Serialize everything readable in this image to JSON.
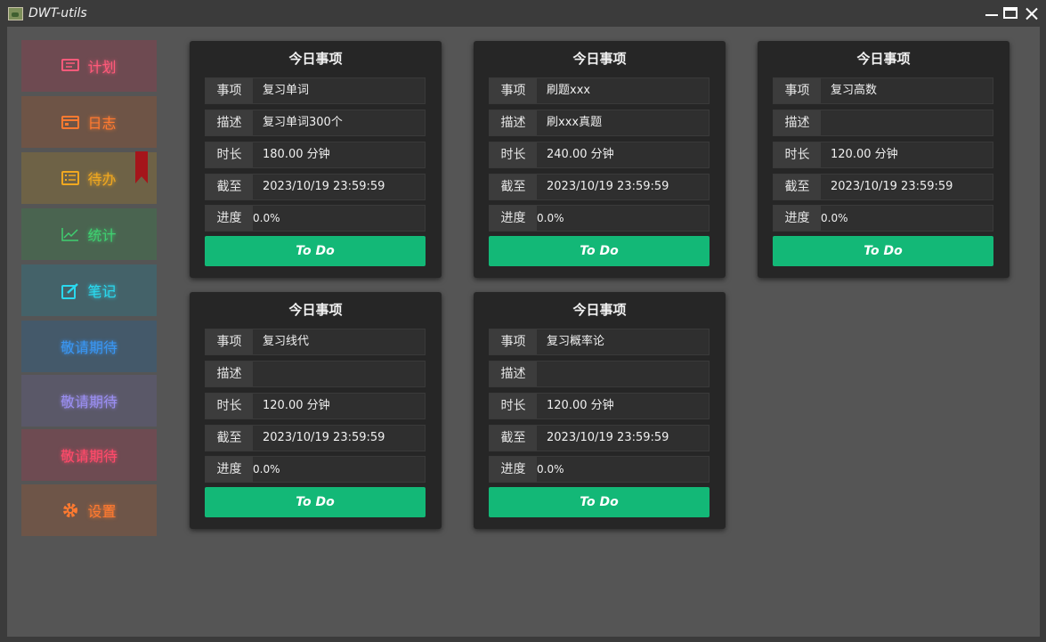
{
  "window": {
    "title": "DWT-utils"
  },
  "sidebar": {
    "items": [
      {
        "label": "计划",
        "icon": "monitor-icon",
        "bg": "#6e4a51",
        "fg": "#ff5a7a"
      },
      {
        "label": "日志",
        "icon": "calendar-icon",
        "bg": "#6e5446",
        "fg": "#ff7a30"
      },
      {
        "label": "待办",
        "icon": "checklist-icon",
        "bg": "#6e6246",
        "fg": "#f0a820"
      },
      {
        "label": "统计",
        "icon": "line-chart-icon",
        "bg": "#4a6450",
        "fg": "#3fcf70"
      },
      {
        "label": "笔记",
        "icon": "edit-icon",
        "bg": "#446269",
        "fg": "#2ad8ee"
      },
      {
        "label": "敬请期待",
        "icon": "",
        "bg": "#44596a",
        "fg": "#3a95f0"
      },
      {
        "label": "敬请期待",
        "icon": "",
        "bg": "#5a5868",
        "fg": "#9a8ef0"
      },
      {
        "label": "敬请期待",
        "icon": "",
        "bg": "#6e4b52",
        "fg": "#ff4a6a"
      },
      {
        "label": "设置",
        "icon": "gear-icon",
        "bg": "#6e5548",
        "fg": "#ff7a30"
      }
    ]
  },
  "cards": [
    {
      "title": "今日事项",
      "rows": [
        {
          "label": "事项",
          "value": "复习单词"
        },
        {
          "label": "描述",
          "value": "复习单词300个"
        },
        {
          "label": "时长",
          "value": "180.00 分钟"
        },
        {
          "label": "截至",
          "value": "2023/10/19 23:59:59"
        },
        {
          "label": "进度",
          "value": "0.0%"
        }
      ],
      "button": "To Do"
    },
    {
      "title": "今日事项",
      "rows": [
        {
          "label": "事项",
          "value": "刷题xxx"
        },
        {
          "label": "描述",
          "value": "刷xxx真题"
        },
        {
          "label": "时长",
          "value": "240.00 分钟"
        },
        {
          "label": "截至",
          "value": "2023/10/19 23:59:59"
        },
        {
          "label": "进度",
          "value": "0.0%"
        }
      ],
      "button": "To Do"
    },
    {
      "title": "今日事项",
      "rows": [
        {
          "label": "事项",
          "value": "复习高数"
        },
        {
          "label": "描述",
          "value": ""
        },
        {
          "label": "时长",
          "value": "120.00 分钟"
        },
        {
          "label": "截至",
          "value": "2023/10/19 23:59:59"
        },
        {
          "label": "进度",
          "value": "0.0%"
        }
      ],
      "button": "To Do"
    },
    {
      "title": "今日事项",
      "rows": [
        {
          "label": "事项",
          "value": "复习线代"
        },
        {
          "label": "描述",
          "value": ""
        },
        {
          "label": "时长",
          "value": "120.00 分钟"
        },
        {
          "label": "截至",
          "value": "2023/10/19 23:59:59"
        },
        {
          "label": "进度",
          "value": "0.0%"
        }
      ],
      "button": "To Do"
    },
    {
      "title": "今日事项",
      "rows": [
        {
          "label": "事项",
          "value": "复习概率论"
        },
        {
          "label": "描述",
          "value": ""
        },
        {
          "label": "时长",
          "value": "120.00 分钟"
        },
        {
          "label": "截至",
          "value": "2023/10/19 23:59:59"
        },
        {
          "label": "进度",
          "value": "0.0%"
        }
      ],
      "button": "To Do"
    }
  ]
}
